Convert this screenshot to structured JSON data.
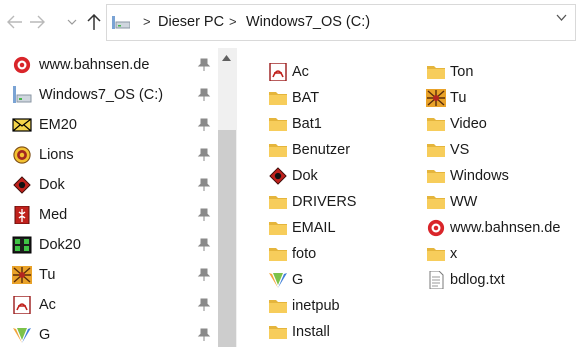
{
  "toolbar": {
    "back_icon": "arrow-left-icon",
    "forward_icon": "arrow-right-icon",
    "recent_icon": "chevron-down-icon",
    "up_icon": "arrow-up-icon"
  },
  "address": {
    "segments": [
      "Dieser PC",
      "Windows7_OS (C:)"
    ],
    "separator": ">",
    "dropdown_icon": "chevron-down-icon"
  },
  "navpane": {
    "items": [
      {
        "label": "www.bahnsen.de",
        "icon": "bahnsen-logo-icon"
      },
      {
        "label": "Windows7_OS (C:)",
        "icon": "drive-icon"
      },
      {
        "label": "EM20",
        "icon": "envelope-icon"
      },
      {
        "label": "Lions",
        "icon": "lions-logo-icon"
      },
      {
        "label": "Dok",
        "icon": "dok-app-icon"
      },
      {
        "label": "Med",
        "icon": "med-app-icon"
      },
      {
        "label": "Dok20",
        "icon": "dok20-app-icon"
      },
      {
        "label": "Tu",
        "icon": "tu-app-icon"
      },
      {
        "label": "Ac",
        "icon": "acrobat-icon"
      },
      {
        "label": "G",
        "icon": "g-app-icon"
      }
    ]
  },
  "files": {
    "column1": [
      {
        "label": "Ac",
        "icon": "acrobat-icon"
      },
      {
        "label": "BAT",
        "icon": "folder-icon"
      },
      {
        "label": "Bat1",
        "icon": "folder-icon"
      },
      {
        "label": "Benutzer",
        "icon": "folder-icon"
      },
      {
        "label": "Dok",
        "icon": "dok-app-icon"
      },
      {
        "label": "DRIVERS",
        "icon": "folder-icon"
      },
      {
        "label": "EMAIL",
        "icon": "folder-icon"
      },
      {
        "label": "foto",
        "icon": "folder-icon"
      },
      {
        "label": "G",
        "icon": "g-app-icon"
      },
      {
        "label": "inetpub",
        "icon": "folder-icon"
      },
      {
        "label": "Install",
        "icon": "folder-icon"
      }
    ],
    "column2": [
      {
        "label": "Ton",
        "icon": "folder-icon"
      },
      {
        "label": "Tu",
        "icon": "tu-app-icon"
      },
      {
        "label": "Video",
        "icon": "folder-icon"
      },
      {
        "label": "VS",
        "icon": "folder-icon"
      },
      {
        "label": "Windows",
        "icon": "folder-icon"
      },
      {
        "label": "WW",
        "icon": "folder-icon"
      },
      {
        "label": "www.bahnsen.de",
        "icon": "bahnsen-logo-icon"
      },
      {
        "label": "x",
        "icon": "folder-icon"
      },
      {
        "label": "bdlog.txt",
        "icon": "text-file-icon"
      }
    ]
  },
  "colors": {
    "folder": "#f7cd5b",
    "folder_dark": "#e5b53c",
    "accent_red": "#d9252a",
    "pin": "#8a8a8a",
    "scroll_thumb": "#cdcdcd"
  }
}
